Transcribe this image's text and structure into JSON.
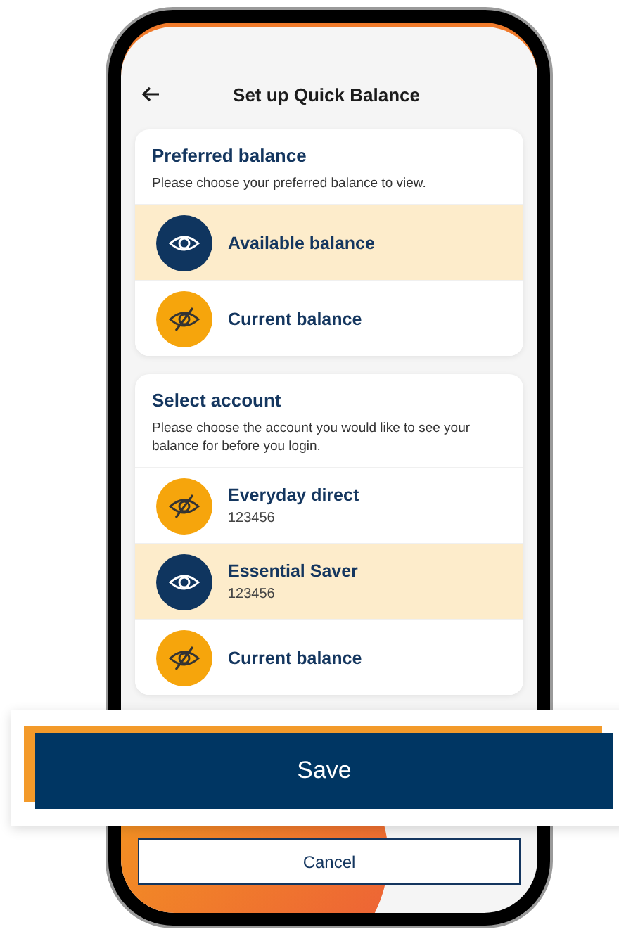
{
  "header": {
    "title": "Set up Quick Balance"
  },
  "sections": [
    {
      "title": "Preferred balance",
      "description": "Please choose your preferred balance to view.",
      "options": [
        {
          "label": "Available balance",
          "selected": true
        },
        {
          "label": "Current balance",
          "selected": false
        }
      ]
    },
    {
      "title": "Select account",
      "description": "Please choose the account you would like to see your balance for before you login.",
      "options": [
        {
          "label": "Everyday direct",
          "number": "123456",
          "selected": false
        },
        {
          "label": "Essential Saver",
          "number": "123456",
          "selected": true
        },
        {
          "label": "Current balance",
          "selected": false
        }
      ]
    }
  ],
  "buttons": [
    {
      "kind": "primary",
      "label": "Save"
    },
    {
      "kind": "secondary",
      "label": "Cancel"
    }
  ]
}
